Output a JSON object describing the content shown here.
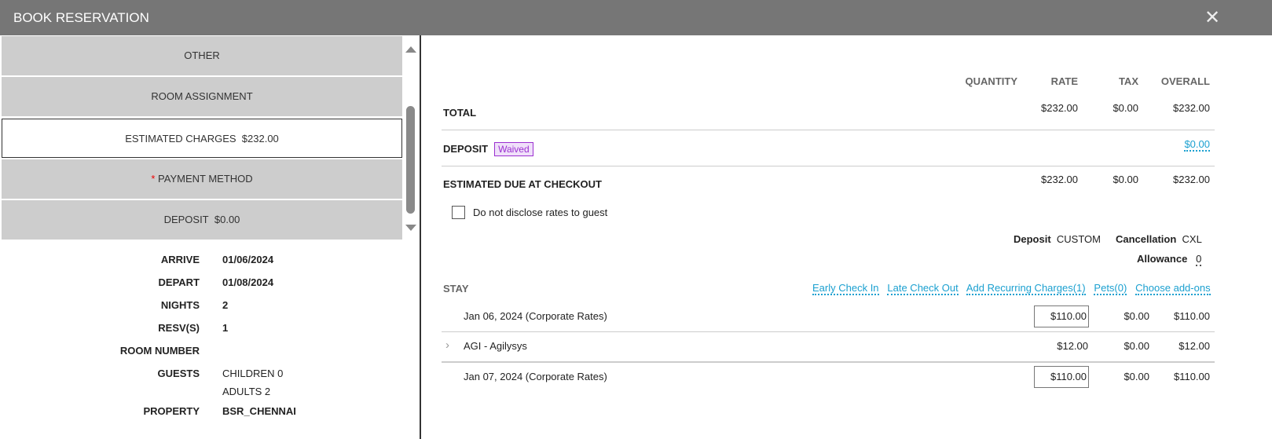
{
  "header": {
    "title": "BOOK RESERVATION",
    "close_icon": "close-icon"
  },
  "accordion": [
    {
      "label": "OTHER"
    },
    {
      "label": "ROOM ASSIGNMENT"
    },
    {
      "label": "ESTIMATED CHARGES",
      "value": "$232.00"
    },
    {
      "label": "PAYMENT METHOD",
      "required": "*"
    },
    {
      "label": "DEPOSIT",
      "value": "$0.00"
    }
  ],
  "details": {
    "arrive_label": "ARRIVE",
    "arrive": "01/06/2024",
    "depart_label": "DEPART",
    "depart": "01/08/2024",
    "nights_label": "NIGHTS",
    "nights": "2",
    "resv_label": "RESV(S)",
    "resv": "1",
    "room_label": "ROOM NUMBER",
    "guests_label": "GUESTS",
    "children": "CHILDREN 0",
    "adults": "ADULTS 2",
    "property_label": "PROPERTY",
    "property": "BSR_CHENNAI"
  },
  "summary": {
    "columns": [
      "QUANTITY",
      "RATE",
      "TAX",
      "OVERALL"
    ],
    "total": {
      "label": "TOTAL",
      "rate": "$232.00",
      "tax": "$0.00",
      "overall": "$232.00"
    },
    "deposit": {
      "label": "DEPOSIT",
      "badge": "Waived",
      "overall": "$0.00"
    },
    "due": {
      "label": "ESTIMATED DUE AT CHECKOUT",
      "rate": "$232.00",
      "tax": "$0.00",
      "overall": "$232.00"
    },
    "disclose_label": "Do not disclose rates to guest",
    "disclose_checked": false
  },
  "policy": {
    "deposit_label": "Deposit",
    "deposit": "CUSTOM",
    "cancel_label": "Cancellation",
    "cancel": "CXL",
    "allowance_label": "Allowance",
    "allowance": "0"
  },
  "stay": {
    "label": "STAY",
    "links": [
      "Early Check In",
      "Late Check Out",
      "Add Recurring Charges(1)",
      "Pets(0)",
      "Choose add-ons"
    ],
    "rows": [
      {
        "desc": "Jan 06, 2024 (Corporate Rates)",
        "rate": "$110.00",
        "tax": "$0.00",
        "overall": "$110.00"
      },
      {
        "desc": "AGI - Agilysys",
        "rate": "$12.00",
        "tax": "$0.00",
        "overall": "$12.00"
      },
      {
        "desc": "Jan 07, 2024 (Corporate Rates)",
        "rate": "$110.00",
        "tax": "$0.00",
        "overall": "$110.00"
      }
    ]
  }
}
